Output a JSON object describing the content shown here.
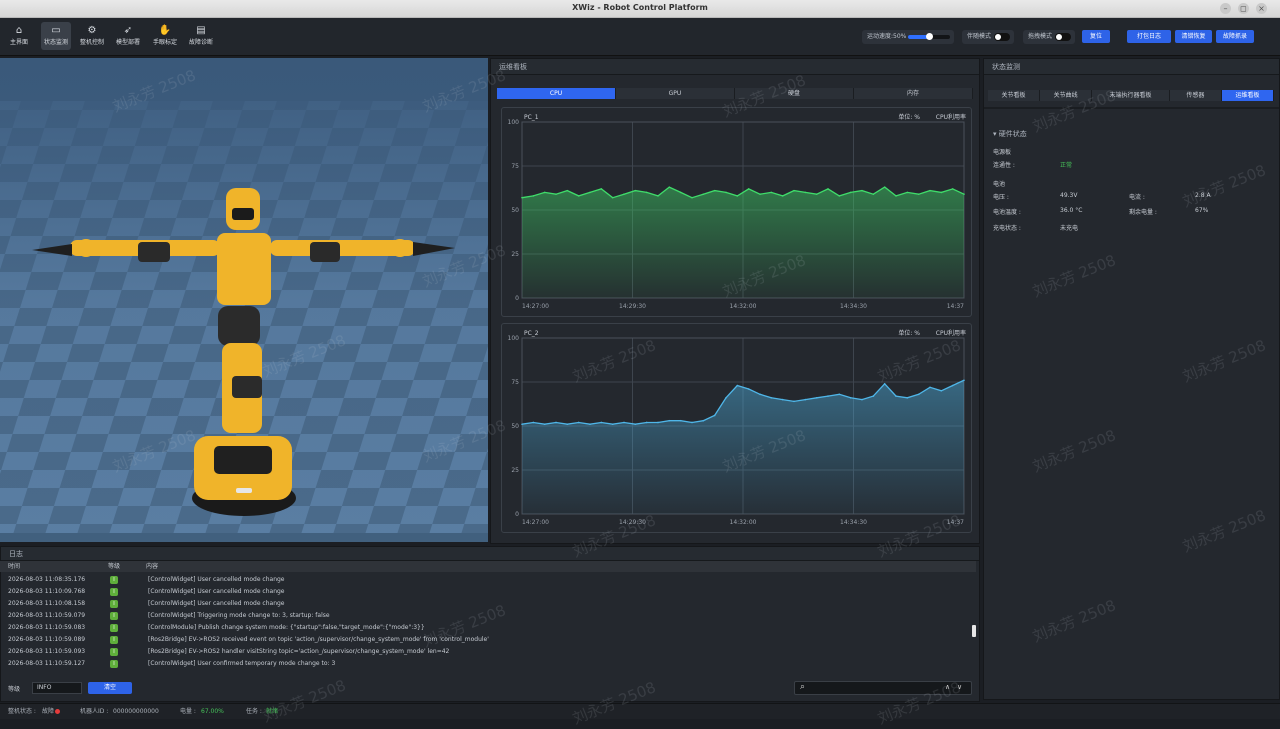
{
  "window": {
    "title": "XWiz - Robot Control Platform",
    "controls": [
      "–",
      "◻",
      "×"
    ]
  },
  "toolbar": {
    "nav": [
      {
        "label": "主界面",
        "icon": "home-icon",
        "glyph": "⌂"
      },
      {
        "label": "状态监测",
        "icon": "monitor-icon",
        "glyph": "▭",
        "active": true
      },
      {
        "label": "整机控制",
        "icon": "robot-control-icon",
        "glyph": "⚙"
      },
      {
        "label": "模型部署",
        "icon": "rocket-icon",
        "glyph": "➶"
      },
      {
        "label": "手眼标定",
        "icon": "hand-icon",
        "glyph": "✋"
      },
      {
        "label": "故障诊断",
        "icon": "diagnosis-icon",
        "glyph": "▤"
      }
    ],
    "speed_label": "运动速度:50%",
    "speed_value": 0.5,
    "mode1_label": "伴随模式",
    "mode2_label": "拖拽模式",
    "reset_label": "复位",
    "btn_log": "打包日志",
    "btn_clear_fault": "清错恢复",
    "btn_fault_record": "故障抓录"
  },
  "monitor": {
    "title": "运维看板",
    "tabs": [
      "CPU",
      "GPU",
      "硬盘",
      "内存"
    ],
    "active_tab": 0,
    "unit_label": "单位: %",
    "cpu_label": "CPU利用率"
  },
  "status": {
    "title": "状态监测",
    "tabs": [
      "关节看板",
      "关节曲线",
      "末端执行器看板",
      "传感器",
      "运维看板"
    ],
    "active_tab": 4,
    "section": "▾ 硬件状态",
    "power_board": "电源板",
    "connectivity_label": "连通性 :",
    "connectivity_value": "正常",
    "battery": "电池",
    "voltage_label": "电压 :",
    "voltage_value": "49.3V",
    "current_label": "电流 :",
    "current_value": "2.8 A",
    "temp_label": "电池温度 :",
    "temp_value": "36.0 °C",
    "remain_label": "剩余电量 :",
    "remain_value": "67%",
    "charge_label": "充电状态 :",
    "charge_value": "未充电"
  },
  "log": {
    "title": "日志",
    "columns": [
      "时间",
      "等级",
      "内容"
    ],
    "rows": [
      {
        "time": "2026-08-03 11:08:35.176",
        "level": "I",
        "content": "[ControlWidget] User cancelled mode change"
      },
      {
        "time": "2026-08-03 11:10:09.768",
        "level": "I",
        "content": "[ControlWidget] User cancelled mode change"
      },
      {
        "time": "2026-08-03 11:10:08.158",
        "level": "I",
        "content": "[ControlWidget] User cancelled mode change"
      },
      {
        "time": "2026-08-03 11:10:59.079",
        "level": "I",
        "content": "[ControlWidget] Triggering mode change to: 3, startup: false"
      },
      {
        "time": "2026-08-03 11:10:59.083",
        "level": "I",
        "content": "[ControlModule] Publish change system mode: {\"startup\":false,\"target_mode\":{\"mode\":3}}"
      },
      {
        "time": "2026-08-03 11:10:59.089",
        "level": "I",
        "content": "[Ros2Bridge] EV->ROS2 received event on topic 'action_/supervisor/change_system_mode' from 'control_module'"
      },
      {
        "time": "2026-08-03 11:10:59.093",
        "level": "I",
        "content": "[Ros2Bridge] EV->ROS2 handler visitString topic='action_/supervisor/change_system_mode' len=42"
      },
      {
        "time": "2026-08-03 11:10:59.127",
        "level": "I",
        "content": "[ControlWidget] User confirmed temporary mode change to: 3"
      }
    ],
    "level_label": "等级",
    "level_value": "INFO",
    "clear_label": "清空",
    "search_placeholder": ""
  },
  "statusbar": {
    "device_label": "整机状态 :",
    "device_value": "故障",
    "robot_id_label": "机器人ID :",
    "robot_id_value": "000000000000",
    "battery_label": "电量 :",
    "battery_value": "67.00%",
    "task_label": "任务 :",
    "task_value": "就绪"
  },
  "watermark_text": "刘永芳 2508",
  "colors": {
    "accent": "#2f66f0",
    "cpu1_line": "#3fdc6a",
    "cpu2_line": "#4fb6e8",
    "ok_green": "#46c35a",
    "fault_red": "#e53b3b"
  },
  "chart_data": [
    {
      "type": "area",
      "title": "PC_1",
      "x_ticks": [
        "14:27:00",
        "14:29:30",
        "14:32:00",
        "14:34:30",
        "14:37"
      ],
      "y_ticks": [
        0,
        25,
        50,
        75,
        100
      ],
      "ylim": [
        0,
        100
      ],
      "ylabel": "单位: %",
      "series": [
        {
          "name": "CPU利用率",
          "values": [
            57,
            58,
            60,
            59,
            61,
            58,
            60,
            62,
            57,
            59,
            61,
            60,
            58,
            63,
            60,
            57,
            59,
            61,
            60,
            58,
            62,
            59,
            60,
            58,
            61,
            60,
            59,
            62,
            58,
            60,
            61,
            59,
            63,
            58,
            60,
            59,
            61,
            60,
            62,
            59
          ]
        }
      ]
    },
    {
      "type": "area",
      "title": "PC_2",
      "x_ticks": [
        "14:27:00",
        "14:29:30",
        "14:32:00",
        "14:34:30",
        "14:37"
      ],
      "y_ticks": [
        0,
        25,
        50,
        75,
        100
      ],
      "ylim": [
        0,
        100
      ],
      "ylabel": "单位: %",
      "series": [
        {
          "name": "CPU利用率",
          "values": [
            51,
            52,
            51,
            52,
            51,
            52,
            51,
            52,
            51,
            52,
            51,
            52,
            52,
            53,
            53,
            52,
            53,
            56,
            66,
            73,
            71,
            68,
            66,
            65,
            64,
            65,
            66,
            67,
            68,
            66,
            65,
            67,
            74,
            67,
            66,
            68,
            72,
            70,
            73,
            76
          ]
        }
      ]
    }
  ]
}
